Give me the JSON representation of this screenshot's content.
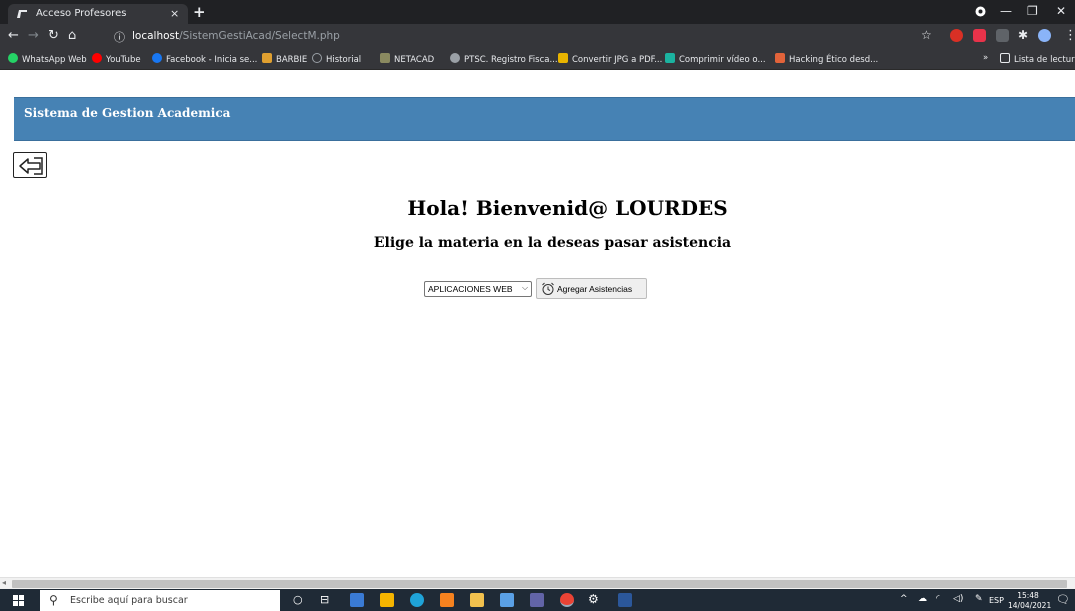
{
  "browser": {
    "tab_title": "Acceso Profesores",
    "tab_close": "×",
    "new_tab": "+",
    "url_host": "localhost",
    "url_path": "/SistemGestiAcad/SelectM.php",
    "bookmarks": [
      {
        "label": "WhatsApp Web",
        "color": "#25d366"
      },
      {
        "label": "YouTube",
        "color": "#ff0000"
      },
      {
        "label": "Facebook - Inicia se...",
        "color": "#1877f2"
      },
      {
        "label": "BARBIE",
        "color": "#e0a030"
      },
      {
        "label": "Historial",
        "color": "#9aa0a6"
      },
      {
        "label": "NETACAD",
        "color": "#8a8a60"
      },
      {
        "label": "PTSC. Registro Fisca...",
        "color": "#9aa0a6"
      },
      {
        "label": "Convertir JPG a PDF...",
        "color": "#e8b400"
      },
      {
        "label": "Comprimir vídeo o...",
        "color": "#1bb3a0"
      },
      {
        "label": "Hacking Ético desd...",
        "color": "#e2633a"
      }
    ],
    "bookmarks_more": "»",
    "reading_list": "Lista de lectura"
  },
  "app": {
    "brand": "Sistema de Gestion Academica",
    "greeting": "Hola! Bienvenid@ LOURDES",
    "subtitle": "Elige la materia en la deseas pasar asistencia",
    "select_value": "APLICACIONES WEB",
    "submit_label": "Agregar Asistencias"
  },
  "taskbar": {
    "search_placeholder": "Escribe aquí para buscar",
    "language": "ESP",
    "time": "15:48",
    "date": "14/04/2021"
  },
  "colors": {
    "header": "#4682b4",
    "browser_dark": "#35363a",
    "taskbar": "#1f2a36"
  }
}
